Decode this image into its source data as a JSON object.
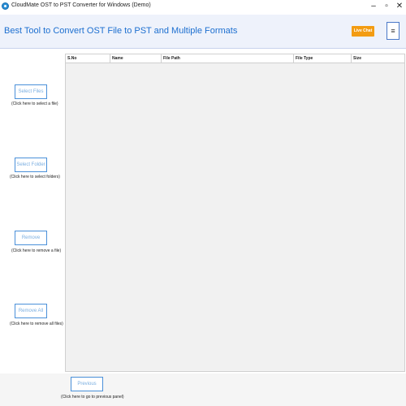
{
  "window": {
    "title": "CloudMate OST to PST Converter for Windows (Demo)",
    "min_glyph": "–",
    "max_glyph": "▫",
    "close_glyph": "✕"
  },
  "header": {
    "headline": "Best Tool to Convert OST File to PST and Multiple Formats",
    "live_chat_label": "Live Chat",
    "menu_glyph": "≡"
  },
  "table": {
    "columns": [
      "S.No",
      "Name",
      "File Path",
      "File Type",
      "Size"
    ],
    "rows": []
  },
  "sidebar": {
    "select_files": {
      "label": "Select Files",
      "caption": "(Click here to select a file)"
    },
    "select_folder": {
      "label": "Select Folder",
      "caption": "(Click here to select folders)"
    },
    "remove": {
      "label": "Remove",
      "caption": "(Click here to remove a file)"
    },
    "remove_all": {
      "label": "Remove All",
      "caption": "(Click here to remove all files)"
    }
  },
  "footer": {
    "previous": {
      "label": "Previous",
      "caption": "(Click here to go to previous panel)"
    }
  },
  "colors": {
    "accent_blue": "#1c6fd0",
    "button_border": "#4a90d9",
    "live_chat_orange": "#f39c12",
    "table_bg": "#f1f1f1"
  }
}
